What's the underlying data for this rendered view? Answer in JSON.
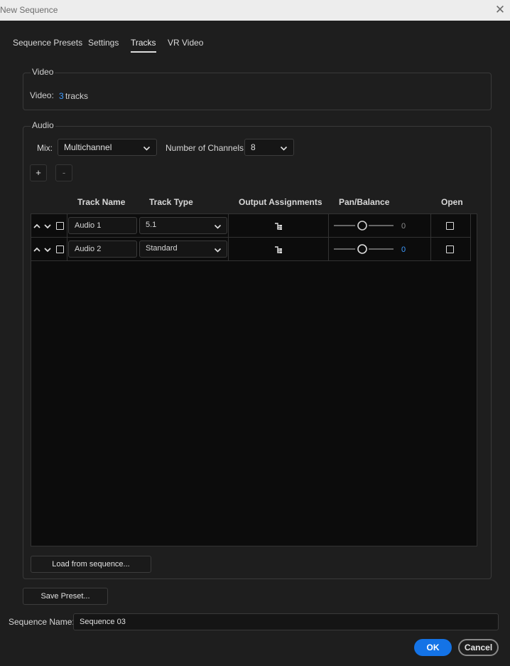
{
  "window": {
    "title": "New Sequence",
    "close_icon": "close-icon"
  },
  "tabs": [
    {
      "label": "Sequence Presets"
    },
    {
      "label": "Settings"
    },
    {
      "label": "Tracks",
      "active": true
    },
    {
      "label": "VR Video"
    }
  ],
  "video": {
    "group_title": "Video",
    "label": "Video:",
    "count": "3",
    "unit": "tracks"
  },
  "audio": {
    "group_title": "Audio",
    "mix_label": "Mix:",
    "mix_value": "Multichannel",
    "channels_label": "Number of Channels:",
    "channels_value": "8",
    "add_label": "+",
    "remove_label": "-",
    "columns": [
      "Track Name",
      "Track Type",
      "Output Assignments",
      "Pan/Balance",
      "Open"
    ],
    "tracks": [
      {
        "name": "Audio 1",
        "type": "5.1",
        "pan": "0",
        "pan_color": "#8a8a8a"
      },
      {
        "name": "Audio 2",
        "type": "Standard",
        "pan": "0",
        "pan_color": "#3f9bff"
      }
    ],
    "load_button": "Load from sequence..."
  },
  "footer": {
    "save_preset": "Save Preset...",
    "sequence_name_label": "Sequence Name:",
    "sequence_name_value": "Sequence 03",
    "ok": "OK",
    "cancel": "Cancel"
  },
  "colors": {
    "accent": "#1473e6",
    "link": "#3f9bff",
    "background": "#1e1e1e"
  }
}
